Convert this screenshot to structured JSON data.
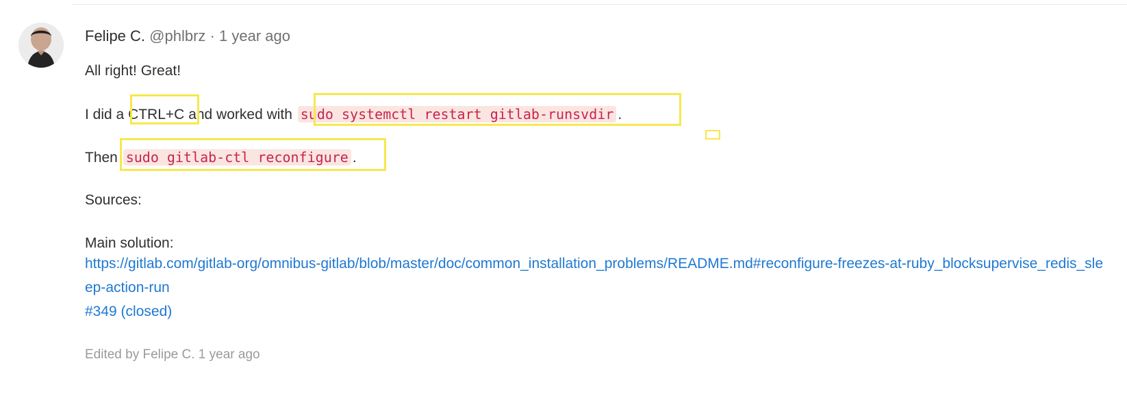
{
  "comment": {
    "author_name": "Felipe C.",
    "author_handle": "@phlbrz",
    "separator": "·",
    "time": "1 year ago",
    "greeting": "All right! Great!",
    "line2_prefix": "I did a",
    "line2_keyword": "CTRL+C",
    "line2_middle": "and worked with",
    "line2_code": "sudo systemctl restart gitlab-runsvdir",
    "line2_suffix": ".",
    "line3_prefix": "Then",
    "line3_code": "sudo gitlab-ctl reconfigure",
    "line3_suffix": ".",
    "sources_label": "Sources:",
    "solution_label": "Main solution:",
    "solution_link": "https://gitlab.com/gitlab-org/omnibus-gitlab/blob/master/doc/common_installation_problems/README.md#reconfigure-freezes-at-ruby_blocksupervise_redis_sleep-action-run",
    "issue_link": "#349 (closed)",
    "edited_text": "Edited by Felipe C. 1 year ago"
  },
  "highlights": {
    "color": "#f7e84b"
  },
  "icons": {
    "avatar": "user-avatar"
  }
}
